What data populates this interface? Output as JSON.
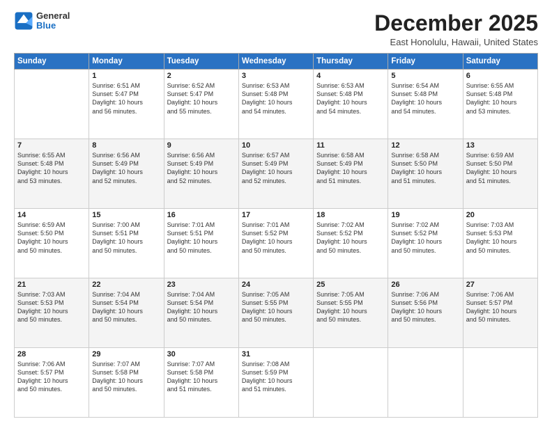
{
  "header": {
    "logo_line1": "General",
    "logo_line2": "Blue",
    "month": "December 2025",
    "location": "East Honolulu, Hawaii, United States"
  },
  "days_of_week": [
    "Sunday",
    "Monday",
    "Tuesday",
    "Wednesday",
    "Thursday",
    "Friday",
    "Saturday"
  ],
  "weeks": [
    [
      {
        "day": "",
        "info": ""
      },
      {
        "day": "1",
        "info": "Sunrise: 6:51 AM\nSunset: 5:47 PM\nDaylight: 10 hours\nand 56 minutes."
      },
      {
        "day": "2",
        "info": "Sunrise: 6:52 AM\nSunset: 5:47 PM\nDaylight: 10 hours\nand 55 minutes."
      },
      {
        "day": "3",
        "info": "Sunrise: 6:53 AM\nSunset: 5:48 PM\nDaylight: 10 hours\nand 54 minutes."
      },
      {
        "day": "4",
        "info": "Sunrise: 6:53 AM\nSunset: 5:48 PM\nDaylight: 10 hours\nand 54 minutes."
      },
      {
        "day": "5",
        "info": "Sunrise: 6:54 AM\nSunset: 5:48 PM\nDaylight: 10 hours\nand 54 minutes."
      },
      {
        "day": "6",
        "info": "Sunrise: 6:55 AM\nSunset: 5:48 PM\nDaylight: 10 hours\nand 53 minutes."
      }
    ],
    [
      {
        "day": "7",
        "info": "Sunrise: 6:55 AM\nSunset: 5:48 PM\nDaylight: 10 hours\nand 53 minutes."
      },
      {
        "day": "8",
        "info": "Sunrise: 6:56 AM\nSunset: 5:49 PM\nDaylight: 10 hours\nand 52 minutes."
      },
      {
        "day": "9",
        "info": "Sunrise: 6:56 AM\nSunset: 5:49 PM\nDaylight: 10 hours\nand 52 minutes."
      },
      {
        "day": "10",
        "info": "Sunrise: 6:57 AM\nSunset: 5:49 PM\nDaylight: 10 hours\nand 52 minutes."
      },
      {
        "day": "11",
        "info": "Sunrise: 6:58 AM\nSunset: 5:49 PM\nDaylight: 10 hours\nand 51 minutes."
      },
      {
        "day": "12",
        "info": "Sunrise: 6:58 AM\nSunset: 5:50 PM\nDaylight: 10 hours\nand 51 minutes."
      },
      {
        "day": "13",
        "info": "Sunrise: 6:59 AM\nSunset: 5:50 PM\nDaylight: 10 hours\nand 51 minutes."
      }
    ],
    [
      {
        "day": "14",
        "info": "Sunrise: 6:59 AM\nSunset: 5:50 PM\nDaylight: 10 hours\nand 50 minutes."
      },
      {
        "day": "15",
        "info": "Sunrise: 7:00 AM\nSunset: 5:51 PM\nDaylight: 10 hours\nand 50 minutes."
      },
      {
        "day": "16",
        "info": "Sunrise: 7:01 AM\nSunset: 5:51 PM\nDaylight: 10 hours\nand 50 minutes."
      },
      {
        "day": "17",
        "info": "Sunrise: 7:01 AM\nSunset: 5:52 PM\nDaylight: 10 hours\nand 50 minutes."
      },
      {
        "day": "18",
        "info": "Sunrise: 7:02 AM\nSunset: 5:52 PM\nDaylight: 10 hours\nand 50 minutes."
      },
      {
        "day": "19",
        "info": "Sunrise: 7:02 AM\nSunset: 5:52 PM\nDaylight: 10 hours\nand 50 minutes."
      },
      {
        "day": "20",
        "info": "Sunrise: 7:03 AM\nSunset: 5:53 PM\nDaylight: 10 hours\nand 50 minutes."
      }
    ],
    [
      {
        "day": "21",
        "info": "Sunrise: 7:03 AM\nSunset: 5:53 PM\nDaylight: 10 hours\nand 50 minutes."
      },
      {
        "day": "22",
        "info": "Sunrise: 7:04 AM\nSunset: 5:54 PM\nDaylight: 10 hours\nand 50 minutes."
      },
      {
        "day": "23",
        "info": "Sunrise: 7:04 AM\nSunset: 5:54 PM\nDaylight: 10 hours\nand 50 minutes."
      },
      {
        "day": "24",
        "info": "Sunrise: 7:05 AM\nSunset: 5:55 PM\nDaylight: 10 hours\nand 50 minutes."
      },
      {
        "day": "25",
        "info": "Sunrise: 7:05 AM\nSunset: 5:55 PM\nDaylight: 10 hours\nand 50 minutes."
      },
      {
        "day": "26",
        "info": "Sunrise: 7:06 AM\nSunset: 5:56 PM\nDaylight: 10 hours\nand 50 minutes."
      },
      {
        "day": "27",
        "info": "Sunrise: 7:06 AM\nSunset: 5:57 PM\nDaylight: 10 hours\nand 50 minutes."
      }
    ],
    [
      {
        "day": "28",
        "info": "Sunrise: 7:06 AM\nSunset: 5:57 PM\nDaylight: 10 hours\nand 50 minutes."
      },
      {
        "day": "29",
        "info": "Sunrise: 7:07 AM\nSunset: 5:58 PM\nDaylight: 10 hours\nand 50 minutes."
      },
      {
        "day": "30",
        "info": "Sunrise: 7:07 AM\nSunset: 5:58 PM\nDaylight: 10 hours\nand 51 minutes."
      },
      {
        "day": "31",
        "info": "Sunrise: 7:08 AM\nSunset: 5:59 PM\nDaylight: 10 hours\nand 51 minutes."
      },
      {
        "day": "",
        "info": ""
      },
      {
        "day": "",
        "info": ""
      },
      {
        "day": "",
        "info": ""
      }
    ]
  ]
}
